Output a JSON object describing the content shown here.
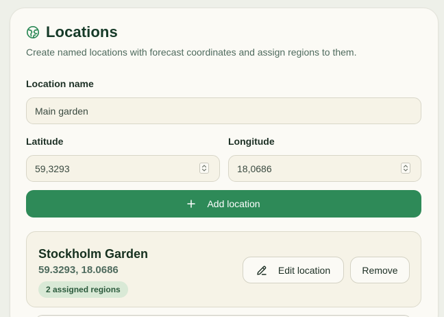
{
  "panel": {
    "title": "Locations",
    "title_icon": "globe-icon",
    "subtitle": "Create named locations with forecast coordinates and assign regions to them."
  },
  "form": {
    "name_label": "Location name",
    "name_value": "Main garden",
    "latitude_label": "Latitude",
    "latitude_value": "59,3293",
    "longitude_label": "Longitude",
    "longitude_value": "18,0686",
    "add_button_label": "Add location",
    "add_button_icon": "plus-icon"
  },
  "locations": [
    {
      "name": "Stockholm Garden",
      "coords": "59.3293, 18.0686",
      "regions_badge": "2 assigned regions",
      "edit_label": "Edit location",
      "edit_icon": "pencil-icon",
      "remove_label": "Remove"
    }
  ],
  "colors": {
    "accent": "#2e8a58",
    "background": "#eef0e9",
    "card": "#fbfaf5",
    "input": "#f6f3e7",
    "badge": "#d9e9d6"
  }
}
